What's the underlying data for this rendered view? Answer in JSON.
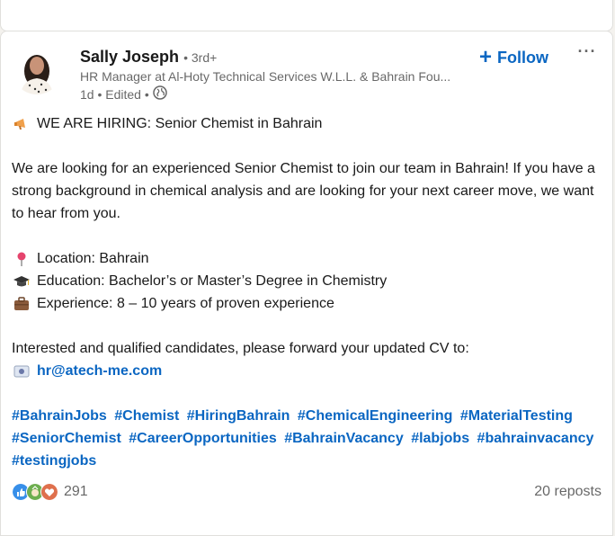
{
  "post": {
    "author": {
      "name": "Sally Joseph",
      "degree": "• 3rd+",
      "headline": "HR Manager at Al-Hoty Technical Services W.L.L. & Bahrain Fou...",
      "time": "1d • Edited •"
    },
    "actions": {
      "follow_label": "Follow",
      "more_label": "···"
    },
    "body": {
      "title": "WE ARE HIRING: Senior Chemist in Bahrain",
      "intro": "We are looking for an experienced Senior Chemist to join our team in Bahrain! If you have a strong background in chemical analysis and are looking for your next career move, we want to hear from you.",
      "location": "Location: Bahrain",
      "education": "Education: Bachelor’s or Master’s Degree in Chemistry",
      "experience": "Experience: 8 – 10 years of proven experience",
      "cta": "Interested and qualified candidates, please forward your updated CV to:",
      "email": "hr@atech-me.com"
    },
    "hashtags": [
      "#BahrainJobs",
      "#Chemist",
      "#HiringBahrain",
      "#ChemicalEngineering",
      "#MaterialTesting",
      "#SeniorChemist",
      "#CareerOpportunities",
      "#BahrainVacancy",
      "#labjobs",
      "#bahrainvacancy",
      "#testingjobs"
    ],
    "social": {
      "reactions_count": "291",
      "reposts": "20 reposts"
    },
    "icons": {
      "megaphone": "megaphone-icon",
      "pin": "pushpin-icon",
      "grad": "graduation-cap-icon",
      "briefcase": "briefcase-icon",
      "email": "email-icon",
      "globe": "globe-icon"
    },
    "colors": {
      "link": "#0a66c2",
      "like": "#378fe9",
      "celebrate": "#6dae4f",
      "love": "#df704d"
    }
  }
}
